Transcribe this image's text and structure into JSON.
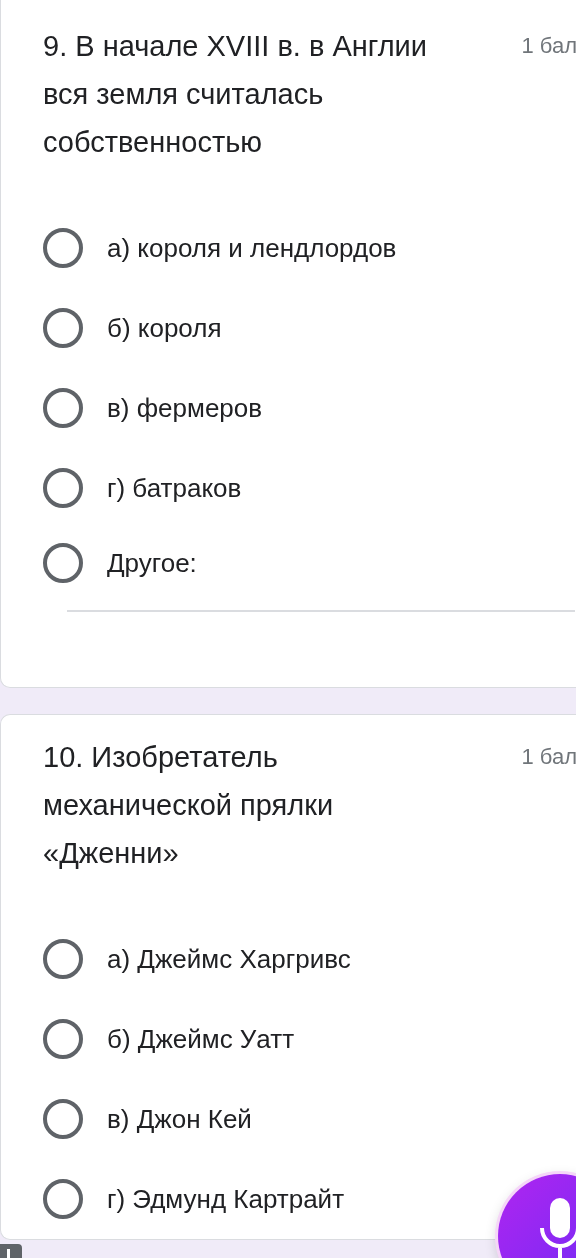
{
  "questions": [
    {
      "title": "9. В начале XVIII в. в Англии вся земля считалась собственностью",
      "points": "1 бал",
      "options": [
        {
          "kind": "choice",
          "label": "а) короля и лендлордов",
          "selected": false
        },
        {
          "kind": "choice",
          "label": "б) короля",
          "selected": false
        },
        {
          "kind": "choice",
          "label": "в) фермеров",
          "selected": false
        },
        {
          "kind": "choice",
          "label": "г) батраков",
          "selected": false
        },
        {
          "kind": "other",
          "label": "Другое:",
          "selected": false
        }
      ]
    },
    {
      "title": "10. Изобретатель механической прялки «Дженни»",
      "points": "1 бал",
      "options": [
        {
          "kind": "choice",
          "label": "а) Джеймс Харгривс",
          "selected": false
        },
        {
          "kind": "choice",
          "label": "б) Джеймс Уатт",
          "selected": false
        },
        {
          "kind": "choice",
          "label": "в) Джон Кей",
          "selected": false
        },
        {
          "kind": "choice",
          "label": "г) Эдмунд Картрайт",
          "selected": false
        }
      ]
    }
  ]
}
